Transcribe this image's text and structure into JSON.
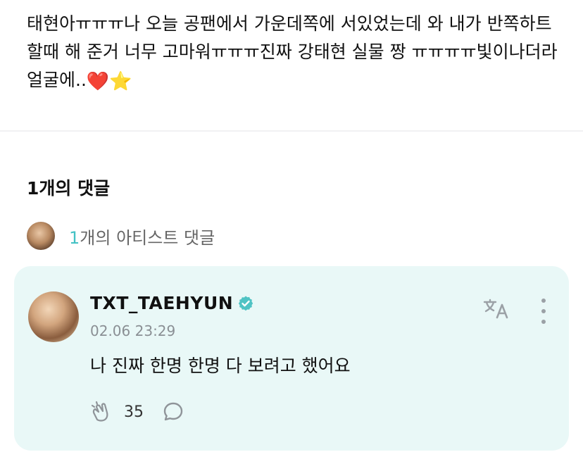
{
  "post": {
    "body_text": "태현아ㅠㅠㅠ나 오늘 공팬에서 가운데쪽에 서있었는데 와 내가 반쪽하트 할때 해 준거 너무 고마워ㅠㅠㅠ진짜 강태현 실물 짱 ㅠㅠㅠㅠ빛이나더라 얼굴에..",
    "emojis": [
      "❤️",
      "⭐"
    ]
  },
  "comments_section": {
    "count_label": "1개의 댓글",
    "artist_summary": {
      "count": "1",
      "label": "개의 아티스트 댓글"
    }
  },
  "comment": {
    "author": "TXT_TAEHYUN",
    "timestamp": "02.06 23:29",
    "text": "나 진짜 한명 한명 다 보려고 했어요",
    "cheer_count": "35",
    "card_color": "#e9f8f7",
    "verified_color": "#4fc3c4",
    "icons": {
      "translate": "translate-icon",
      "more": "more-vertical-icon",
      "cheer": "cheer-icon",
      "reply": "reply-bubble-icon",
      "verified": "verified-badge-icon"
    }
  }
}
